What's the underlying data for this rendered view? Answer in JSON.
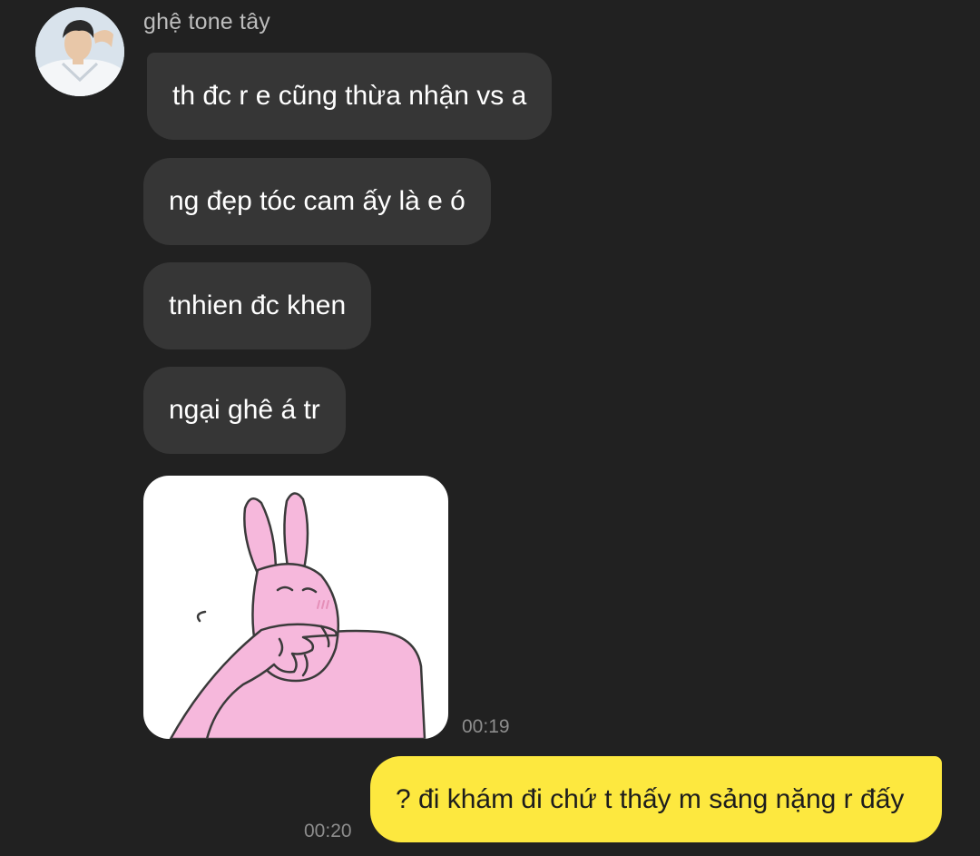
{
  "contact": {
    "name": "ghệ tone tây",
    "avatar_icon": "person-photo-avatar"
  },
  "messages": [
    {
      "text": "th đc r e cũng thừa nhận vs a"
    },
    {
      "text": "ng đẹp tóc cam ấy là e ó"
    },
    {
      "text": "tnhien đc khen"
    },
    {
      "text": "ngại ghê á tr"
    }
  ],
  "sticker": {
    "icon": "pink-rabbit-shy-sticker",
    "time": "00:19"
  },
  "my_message": {
    "text": "? đi khám đi chứ t thấy m sảng nặng r đấy",
    "time": "00:20"
  },
  "colors": {
    "background": "#212121",
    "incoming_bubble": "#363636",
    "outgoing_bubble": "#fde83f",
    "sticker_pink": "#f6b8dc"
  }
}
